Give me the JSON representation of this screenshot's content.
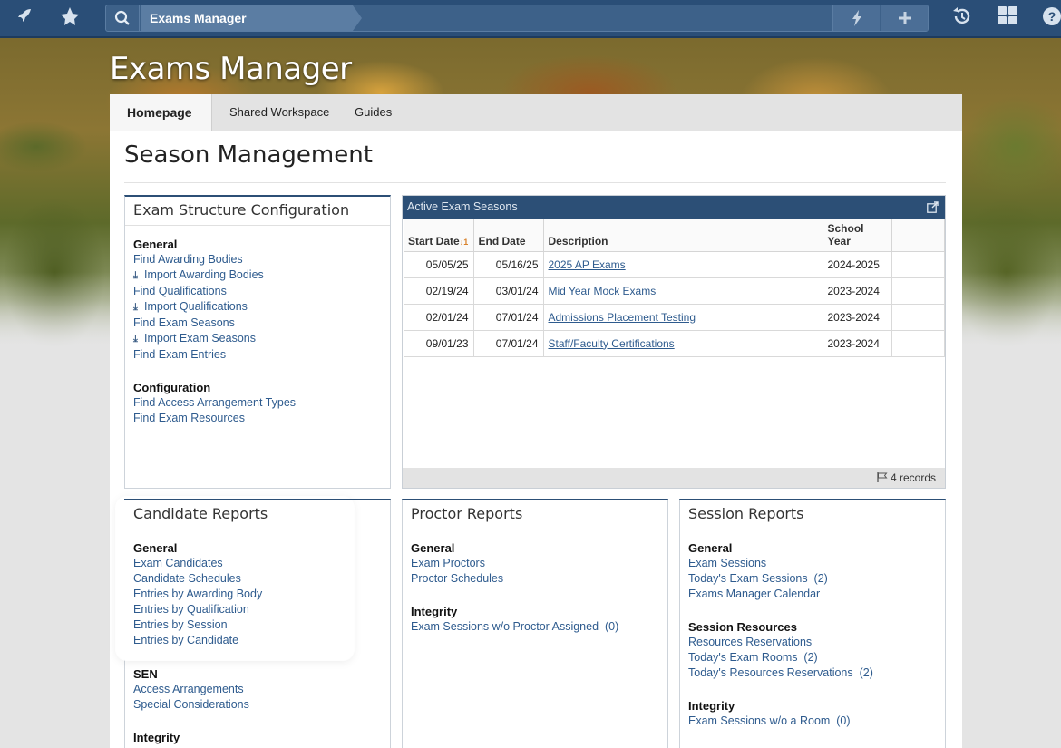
{
  "topbar": {
    "rocket_icon": "rocket-icon",
    "star_icon": "star-icon",
    "search_icon": "search-icon",
    "breadcrumb": "Exams Manager",
    "bolt_icon": "bolt-icon",
    "plus_icon": "plus-icon",
    "history_icon": "history-icon",
    "apps_icon": "grid-icon",
    "help_icon": "help-icon"
  },
  "app_title": "Exams Manager",
  "tabs": [
    "Homepage",
    "Shared Workspace",
    "Guides"
  ],
  "page_title": "Season Management",
  "exam_structure": {
    "title": "Exam Structure Configuration",
    "groups": [
      {
        "title": "General",
        "links": [
          {
            "label": "Find Awarding Bodies",
            "icon": ""
          },
          {
            "label": "Import Awarding Bodies",
            "icon": "download-icon"
          },
          {
            "label": "Find Qualifications",
            "icon": ""
          },
          {
            "label": "Import Qualifications",
            "icon": "download-icon"
          },
          {
            "label": "Find Exam Seasons",
            "icon": ""
          },
          {
            "label": "Import Exam Seasons",
            "icon": "download-icon"
          },
          {
            "label": "Find Exam Entries",
            "icon": ""
          }
        ]
      },
      {
        "title": "Configuration",
        "links": [
          {
            "label": "Find Access Arrangement Types"
          },
          {
            "label": "Find Exam Resources"
          }
        ]
      }
    ]
  },
  "active_seasons": {
    "title": "Active Exam Seasons",
    "columns": [
      "Start Date",
      "End Date",
      "Description",
      "School Year",
      ""
    ],
    "sort_indicator": "↓1",
    "rows": [
      {
        "start": "05/05/25",
        "end": "05/16/25",
        "description": "2025 AP Exams",
        "year": "2024-2025"
      },
      {
        "start": "02/19/24",
        "end": "03/01/24",
        "description": "Mid Year Mock Exams",
        "year": "2023-2024"
      },
      {
        "start": "02/01/24",
        "end": "07/01/24",
        "description": "Admissions Placement Testing",
        "year": "2023-2024"
      },
      {
        "start": "09/01/23",
        "end": "07/01/24",
        "description": "Staff/Faculty Certifications",
        "year": "2023-2024"
      }
    ],
    "record_count": "4 records"
  },
  "candidate_reports": {
    "title": "Candidate Reports",
    "groups": [
      {
        "title": "General",
        "links": [
          "Exam Candidates",
          "Candidate Schedules",
          "Entries by Awarding Body",
          "Entries by Qualification",
          "Entries by Session",
          "Entries by Candidate"
        ]
      },
      {
        "title": "SEN",
        "links": [
          "Access Arrangements",
          "Special Considerations"
        ]
      },
      {
        "title": "Integrity",
        "links": []
      }
    ]
  },
  "proctor_reports": {
    "title": "Proctor Reports",
    "groups": [
      {
        "title": "General",
        "links": [
          "Exam Proctors",
          "Proctor Schedules"
        ]
      },
      {
        "title": "Integrity",
        "links": [
          "Exam Sessions w/o Proctor Assigned  (0)"
        ]
      }
    ]
  },
  "session_reports": {
    "title": "Session Reports",
    "groups": [
      {
        "title": "General",
        "links": [
          "Exam Sessions",
          "Today's Exam Sessions  (2)",
          "Exams Manager Calendar"
        ]
      },
      {
        "title": "Session Resources",
        "links": [
          "Resources Reservations",
          "Today's Exam Rooms  (2)",
          "Today's Resources Reservations  (2)"
        ]
      },
      {
        "title": "Integrity",
        "links": [
          "Exam Sessions w/o a Room  (0)"
        ]
      }
    ]
  }
}
